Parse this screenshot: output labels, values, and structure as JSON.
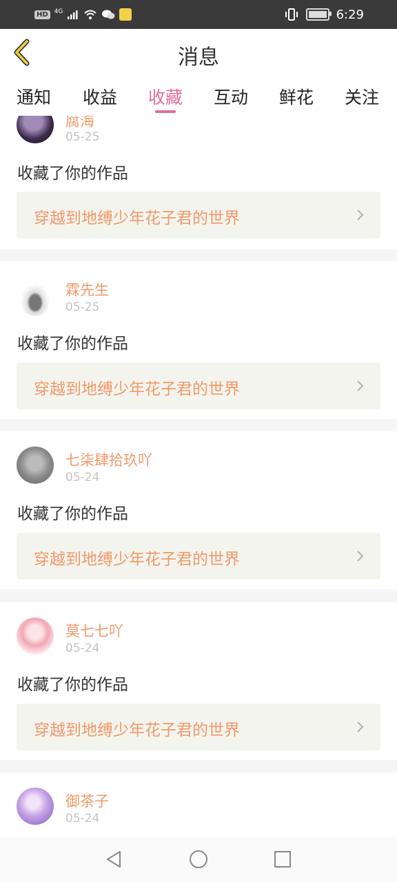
{
  "status_bar": {
    "hd": "HD",
    "network": "4G",
    "time": "6:29"
  },
  "header": {
    "title": "消息"
  },
  "tabs": [
    {
      "label": "通知"
    },
    {
      "label": "收益"
    },
    {
      "label": "收藏",
      "active": true
    },
    {
      "label": "互动"
    },
    {
      "label": "鲜花"
    },
    {
      "label": "关注"
    }
  ],
  "items": [
    {
      "name": "腐海",
      "date": "05-25",
      "message": "收藏了你的作品",
      "work": "穿越到地缚少年花子君的世界"
    },
    {
      "name": "霖先生",
      "date": "05-25",
      "message": "收藏了你的作品",
      "work": "穿越到地缚少年花子君的世界"
    },
    {
      "name": "七柒肆拾玖吖",
      "date": "05-24",
      "message": "收藏了你的作品",
      "work": "穿越到地缚少年花子君的世界"
    },
    {
      "name": "莫七七吖",
      "date": "05-24",
      "message": "收藏了你的作品",
      "work": "穿越到地缚少年花子君的世界"
    },
    {
      "name": "御茶子",
      "date": "05-24"
    }
  ],
  "colors": {
    "accent": "#e46e9c",
    "name": "#f0996a",
    "work_bg": "#f4f4ee"
  }
}
